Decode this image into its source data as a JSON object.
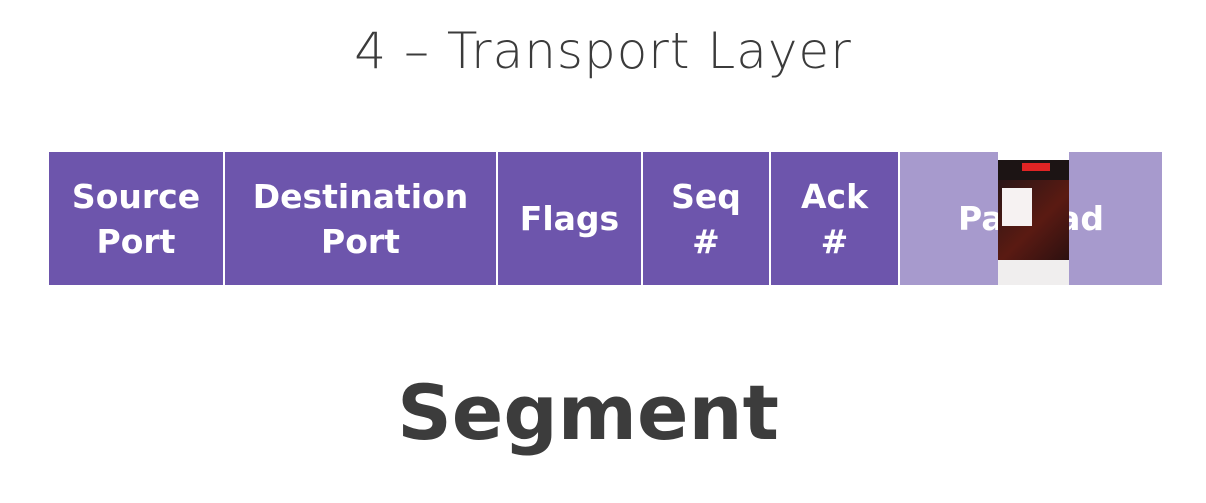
{
  "slide": {
    "title": "4 – Transport Layer",
    "segment_label": "Segment"
  },
  "fields": [
    {
      "label": "Source\nPort"
    },
    {
      "label": "Destination\nPort"
    },
    {
      "label": "Flags"
    },
    {
      "label": "Seq\n#"
    },
    {
      "label": "Ack\n#"
    },
    {
      "label": "Payload"
    }
  ],
  "colors": {
    "header_field": "#6d55ac",
    "payload_field": "#a79acd",
    "text": "#3c3c3c"
  }
}
